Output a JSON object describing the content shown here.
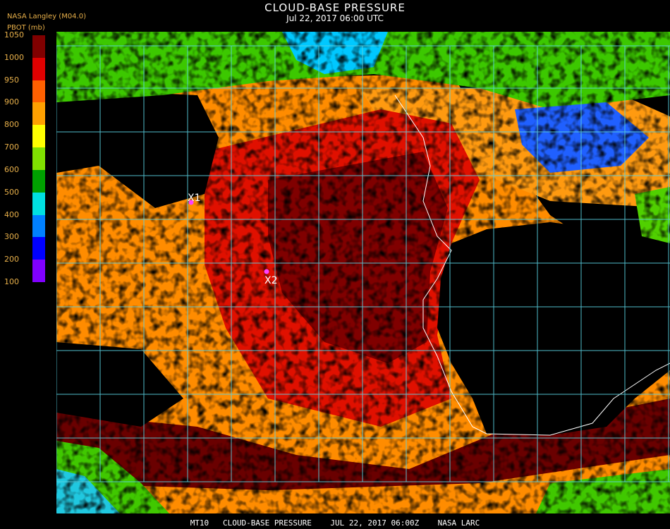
{
  "header": {
    "title": "CLOUD-BASE PRESSURE",
    "subtitle": "Jul 22, 2017 06:00 UTC",
    "source": "NASA Langley (M04.0)",
    "unit_label": "PBOT (mb)"
  },
  "legend": {
    "ticks": [
      "1050",
      "1000",
      "950",
      "900",
      "800",
      "700",
      "600",
      "500",
      "400",
      "300",
      "200",
      "100"
    ],
    "colors": [
      "#800000",
      "#e00000",
      "#ff6000",
      "#ffa000",
      "#ffff00",
      "#80e000",
      "#00a000",
      "#00e0e0",
      "#0080ff",
      "#0000ff",
      "#8000ff"
    ]
  },
  "markers": [
    {
      "label": "X1"
    },
    {
      "label": "X2"
    }
  ],
  "footer": {
    "text": "MT10   CLOUD-BASE PRESSURE    JUL 22, 2017 06:00Z    NASA LARC"
  }
}
